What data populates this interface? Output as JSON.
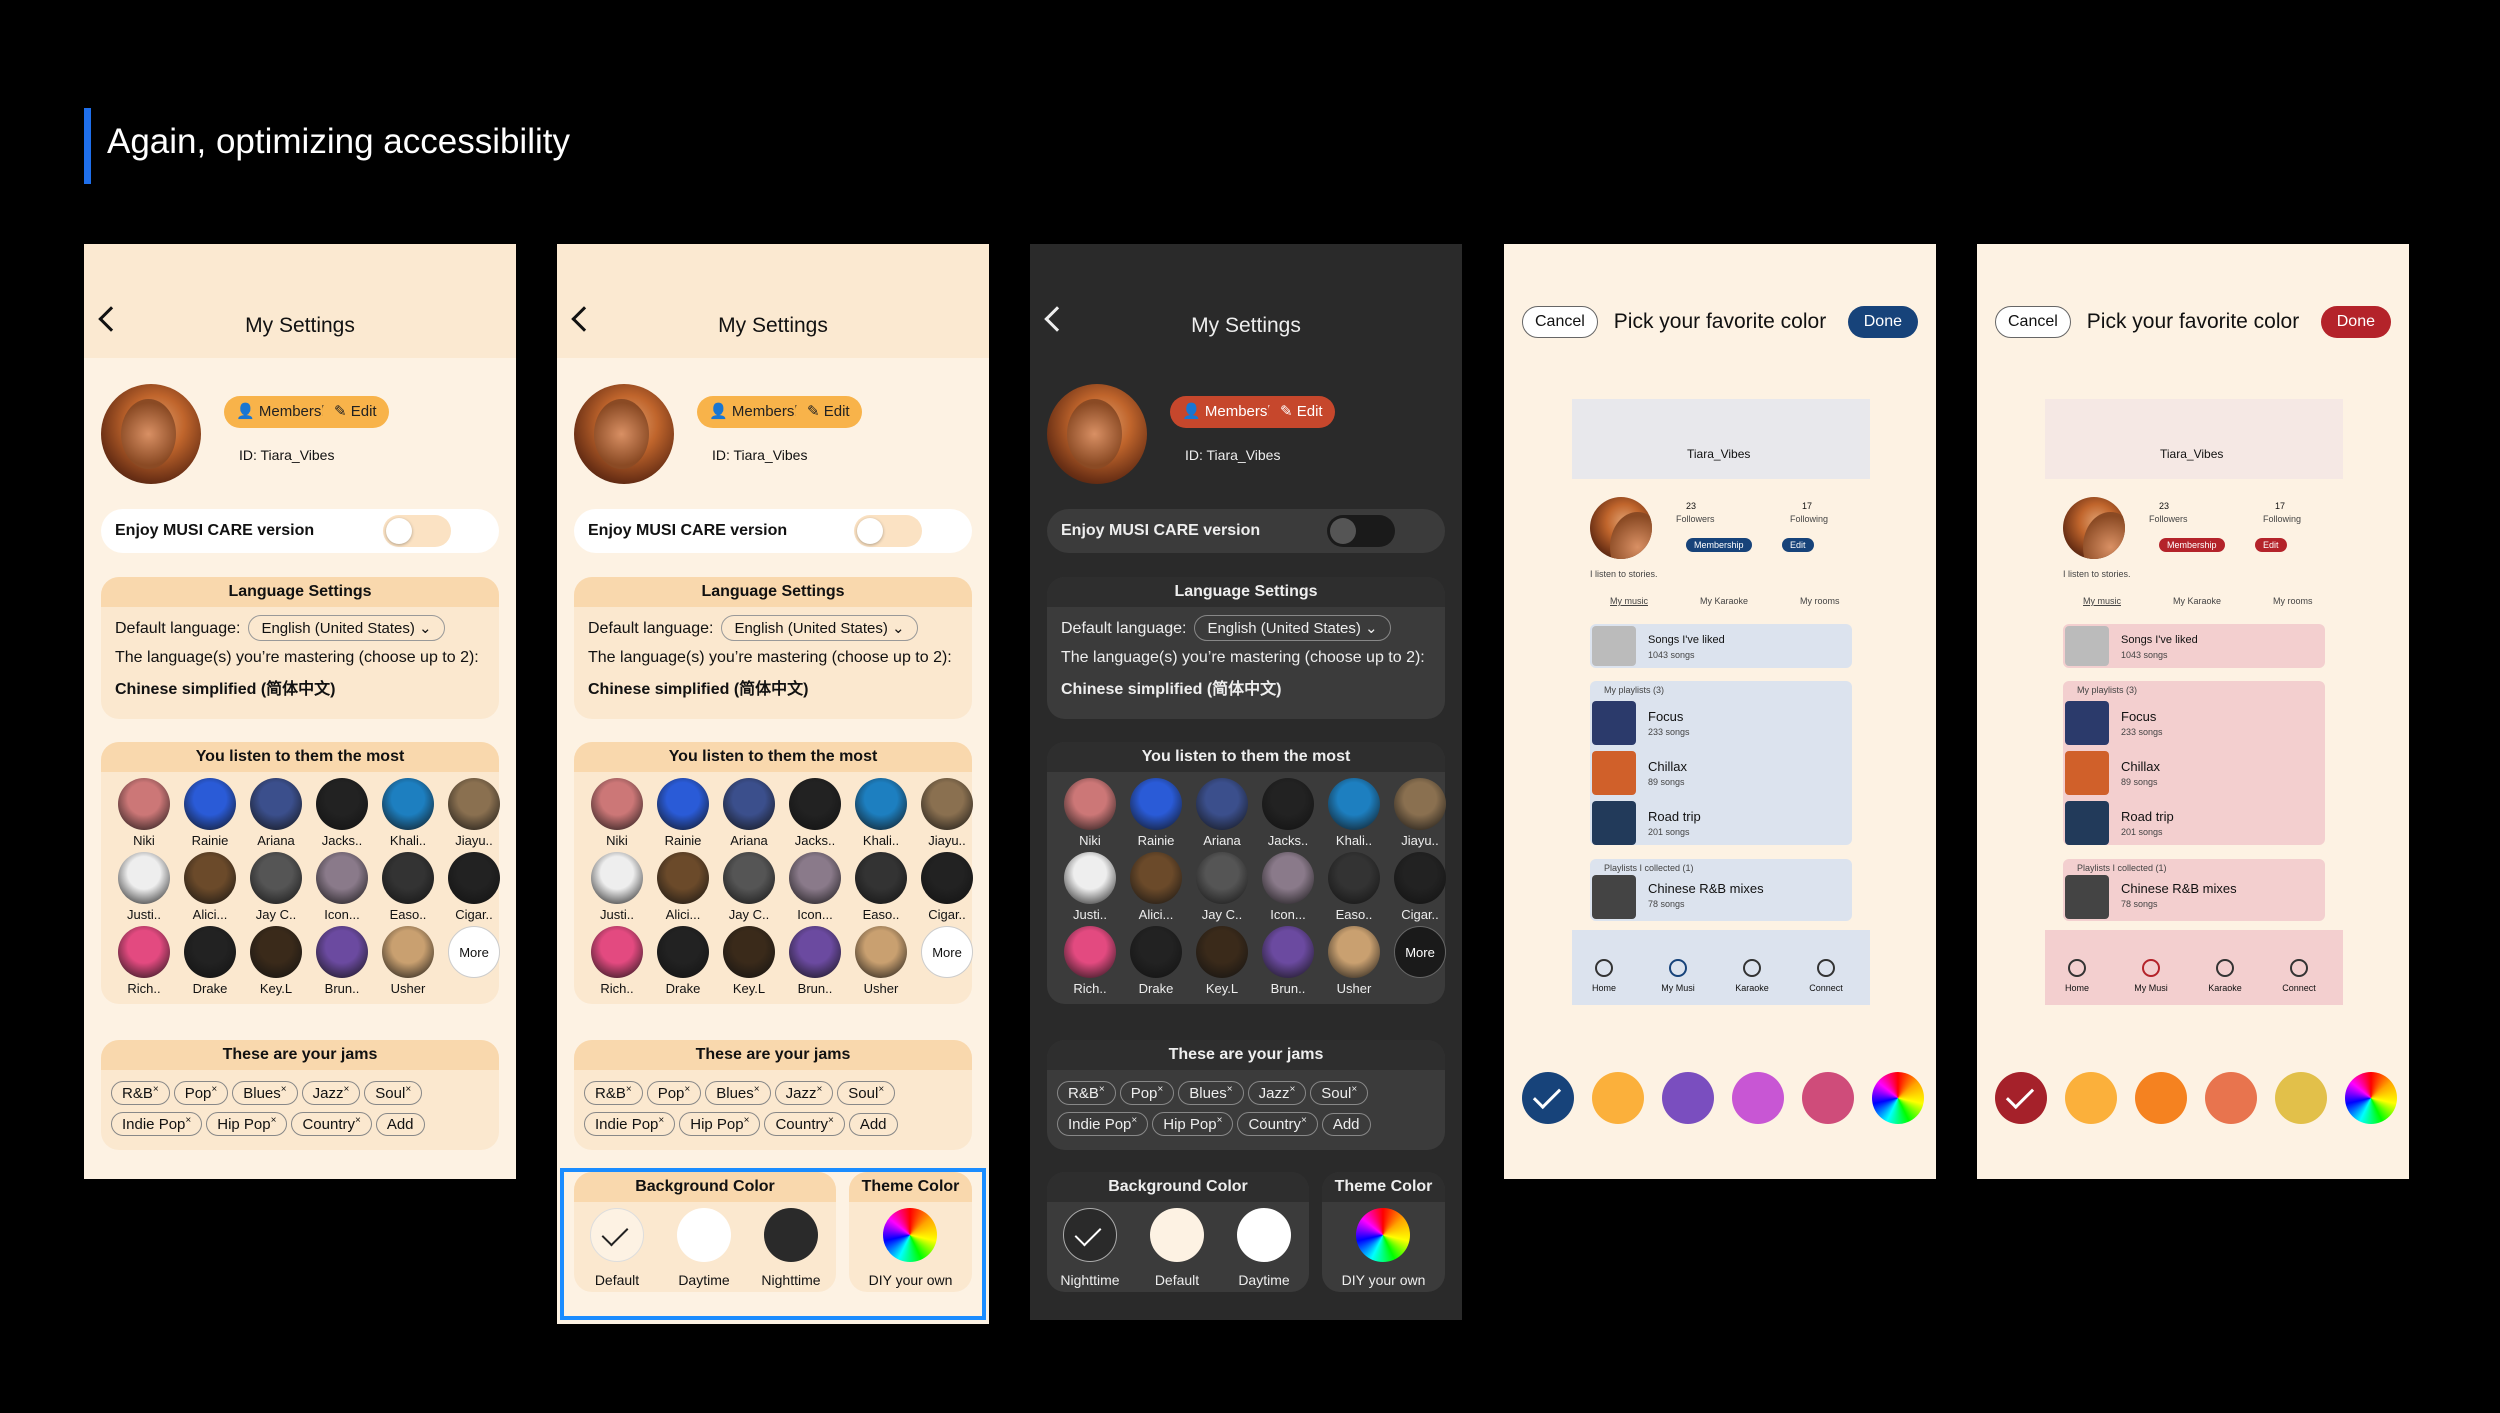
{
  "heading": "Again, optimizing accessibility",
  "settings": {
    "title": "My Settings",
    "membership": "Membership",
    "edit": "Edit",
    "id": "ID: Tiara_Vibes",
    "care": "Enjoy MUSI CARE version",
    "lang_title": "Language Settings",
    "default_lang_label": "Default language:",
    "default_lang_value": "English (United States)",
    "mastering_label": "The language(s) you’re mastering (choose up to 2):",
    "mastering_value": "Chinese simplified (简体中文)",
    "artists_title": "You listen to them the most",
    "artists": [
      "Niki",
      "Rainie",
      "Ariana",
      "Jacks..",
      "Khali..",
      "Jiayu..",
      "Justi..",
      "Alici...",
      "Jay C..",
      "Icon...",
      "Easo..",
      "Cigar..",
      "Rich..",
      "Drake",
      "Key.L",
      "Brun..",
      "Usher",
      "More"
    ],
    "jams_title": "These are your jams",
    "tags_row1": [
      "R&B",
      "Pop",
      "Blues",
      "Jazz",
      "Soul"
    ],
    "tags_row2": [
      "Indie Pop",
      "Hip Pop",
      "Country"
    ],
    "add": "Add"
  },
  "bg": {
    "title": "Background Color",
    "theme_title": "Theme Color",
    "light_labels": [
      "Default",
      "Daytime",
      "Nighttime"
    ],
    "dark_labels": [
      "Nighttime",
      "Default",
      "Daytime"
    ],
    "diy": "DIY your own"
  },
  "pick": {
    "cancel": "Cancel",
    "title": "Pick your favorite color",
    "done": "Done",
    "username": "Tiara_Vibes",
    "followers_n": "23",
    "followers": "Followers",
    "following_n": "17",
    "following": "Following",
    "membership": "Membership",
    "edit": "Edit",
    "bio": "I listen to stories.",
    "tabs": [
      "My music",
      "My Karaoke",
      "My rooms"
    ],
    "liked": "Songs I've liked",
    "liked_count": "1043 songs",
    "playlists_head": "My playlists (3)",
    "playlists": [
      {
        "name": "Focus",
        "count": "233 songs"
      },
      {
        "name": "Chillax",
        "count": "89 songs"
      },
      {
        "name": "Road trip",
        "count": "201 songs"
      }
    ],
    "collected_head": "Playlists I collected (1)",
    "collected": {
      "name": "Chinese R&B mixes",
      "count": "78 songs"
    },
    "nav": [
      "Home",
      "My Musi",
      "Karaoke",
      "Connect"
    ]
  },
  "colors": {
    "blue_swatches": [
      "#17437a",
      "#fbb03b",
      "#7a4ebf",
      "#c856d4",
      "#cf4c7a"
    ],
    "red_swatches": [
      "#a5212a",
      "#fbb03b",
      "#f58220",
      "#e8744e",
      "#e2c04a"
    ],
    "blue_accent": "#17437a",
    "red_accent": "#b4232a"
  }
}
